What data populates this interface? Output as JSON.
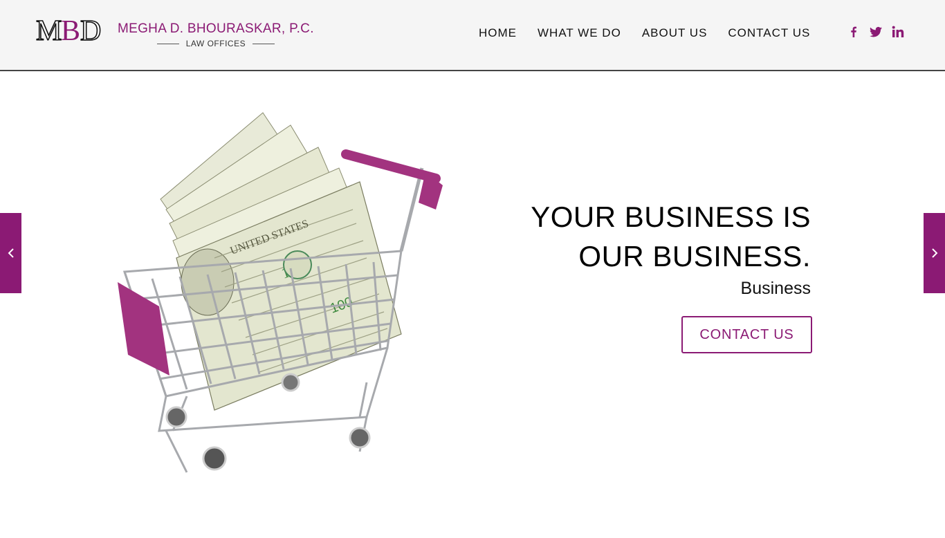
{
  "brand": {
    "mark_letters": [
      "M",
      "B",
      "D"
    ],
    "name": "MEGHA D. BHOURASKAR, P.C.",
    "subtitle": "LAW OFFICES",
    "color": "#8b1a74"
  },
  "nav": {
    "items": [
      {
        "label": "HOME"
      },
      {
        "label": "WHAT WE DO"
      },
      {
        "label": "ABOUT US"
      },
      {
        "label": "CONTACT US"
      }
    ]
  },
  "social": [
    {
      "icon": "facebook-icon"
    },
    {
      "icon": "twitter-icon"
    },
    {
      "icon": "linkedin-icon"
    }
  ],
  "hero": {
    "headline_lines": [
      "YOUR BUSINESS IS",
      "OUR BUSINESS."
    ],
    "subheading": "Business",
    "cta_label": "CONTACT US",
    "image": "shopping-cart-with-dollar-bills"
  },
  "slider": {
    "prev_icon": "chevron-left-icon",
    "next_icon": "chevron-right-icon"
  },
  "colors": {
    "accent": "#8b1a74",
    "header_bg": "#f5f5f5"
  }
}
